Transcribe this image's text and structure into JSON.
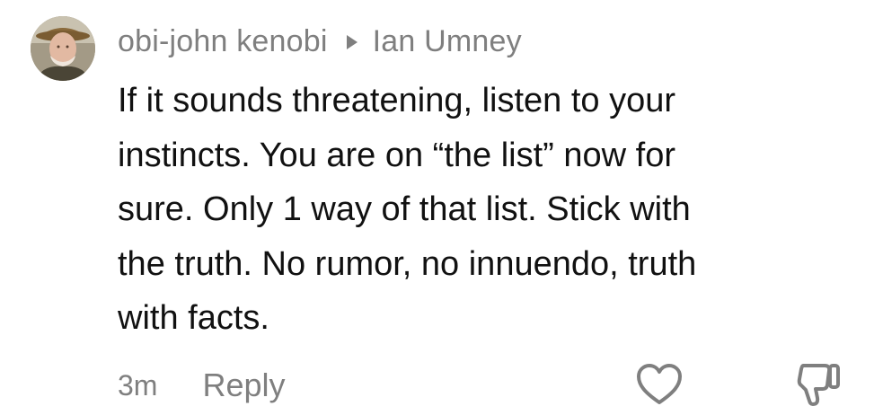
{
  "comment": {
    "author": "obi-john kenobi",
    "reply_to": "Ian Umney",
    "text": "If it sounds threatening, listen to your\ninstincts. You are on “the list” now for\nsure. Only 1 way of that list. Stick with\nthe truth. No rumor, no innuendo, truth\nwith facts.",
    "timestamp": "3m",
    "reply_label": "Reply"
  },
  "icons": {
    "reply_to": "caret-right-icon",
    "like": "heart-outline-icon",
    "dislike": "thumbs-down-icon"
  },
  "colors": {
    "background": "#ffffff",
    "text_primary": "#111111",
    "text_secondary": "#7f7f7f"
  }
}
